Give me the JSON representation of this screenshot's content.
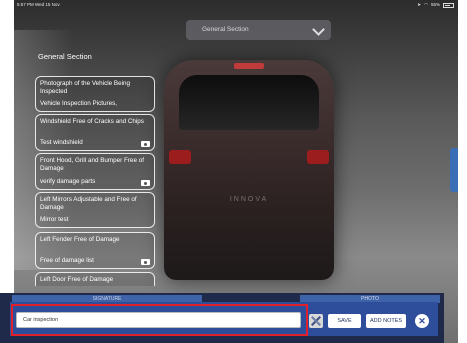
{
  "status_bar": {
    "time": "5:57 PM  Wed 15 Nov",
    "battery": "55%",
    "icons": [
      "location-icon",
      "wifi-icon",
      "battery-icon"
    ]
  },
  "section_dropdown": {
    "selected": "General Section",
    "icon": "chevron-down-icon"
  },
  "checklist": {
    "title": "General Section",
    "items": [
      {
        "title": "Photograph of the Vehicle Being Inspected",
        "sub": "Vehicle Inspection Pictures,",
        "camera": false
      },
      {
        "title": "Windshield Free of Cracks and Chips",
        "sub": "Test windshield",
        "camera": true
      },
      {
        "title": "Front Hood, Grill and Bumper Free of Damage",
        "sub": "verify damage parts",
        "camera": true
      },
      {
        "title": "Left Mirrors Adjustable and Free of Damage",
        "sub": "Mirror test",
        "camera": false
      },
      {
        "title": "Left Fender Free of Damage",
        "sub": "Free of damage list",
        "camera": true
      },
      {
        "title": "Left Door Free of Damage",
        "sub": "",
        "camera": false
      }
    ]
  },
  "background": {
    "plate_text": "INNOVA"
  },
  "bottom_tabs": {
    "left": "SIGNATURE",
    "right": "PHOTO"
  },
  "toolbar": {
    "notes_value": "Car inspection",
    "save_label": "SAVE",
    "add_notes_label": "ADD NOTES",
    "close_symbol": "✕"
  },
  "colors": {
    "toolbar_bg": "#2e4d9a",
    "highlight": "#e0202a",
    "tab_bg": "#3f63a8"
  }
}
